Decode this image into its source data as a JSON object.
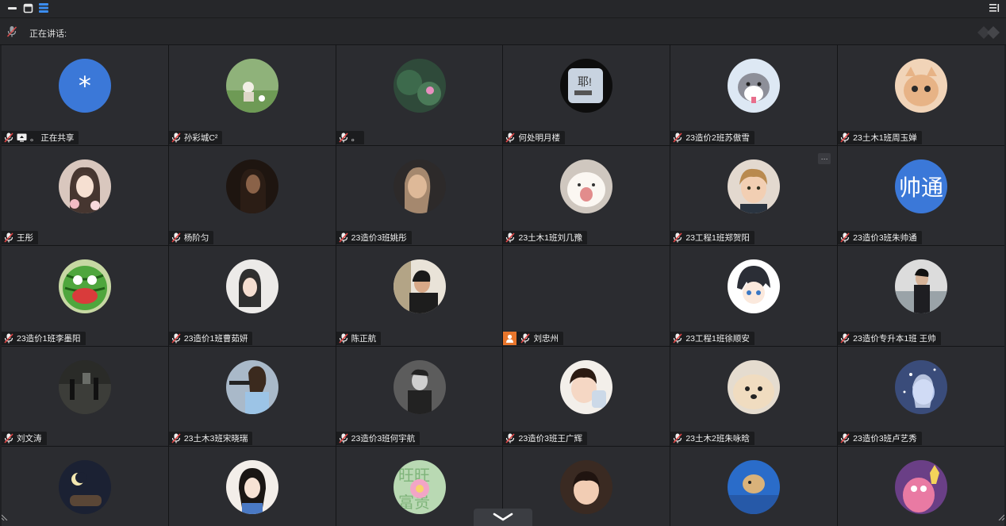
{
  "window": {
    "controls": [
      "minimize-icon",
      "window-icon",
      "layout-icon"
    ],
    "right_control": "collapse-menu-icon"
  },
  "speaking": {
    "label": "正在讲话:"
  },
  "colors": {
    "accent": "#3b78d8",
    "person_badge": "#e8762c",
    "tile_bg": "#2b2c30"
  },
  "participants": [
    {
      "name": "。 正在共享",
      "avatar": "*",
      "sharing": true
    },
    {
      "name": "孙彩城C²"
    },
    {
      "name": "。"
    },
    {
      "name": "何处明月楼"
    },
    {
      "name": "23造价2班苏傲雪"
    },
    {
      "name": "23土木1班周玉婵"
    },
    {
      "name": "王彤"
    },
    {
      "name": "杨阶匀"
    },
    {
      "name": "23造价3班姚彤"
    },
    {
      "name": "23土木1班刘几豫"
    },
    {
      "name": "23工程1班郑贺阳",
      "more": "···"
    },
    {
      "name": "23造价3班朱帅通",
      "avatar": "帅通"
    },
    {
      "name": "23造价1班李墨阳"
    },
    {
      "name": "23造价1班曹茹妍"
    },
    {
      "name": "陈正航"
    },
    {
      "name": "刘忠州",
      "no_avatar": true
    },
    {
      "name": "23工程1班徐顺安"
    },
    {
      "name": "23造价专升本1班 王帅"
    },
    {
      "name": "刘文涛"
    },
    {
      "name": "23土木3班宋晓瑞"
    },
    {
      "name": "23造价3班何宇航"
    },
    {
      "name": "23造价3班王广辉"
    },
    {
      "name": "23土木2班朱咏晗"
    },
    {
      "name": "23造价3班卢艺秀"
    },
    {
      "name": ""
    },
    {
      "name": ""
    },
    {
      "name": ""
    },
    {
      "name": ""
    },
    {
      "name": ""
    },
    {
      "name": ""
    }
  ]
}
